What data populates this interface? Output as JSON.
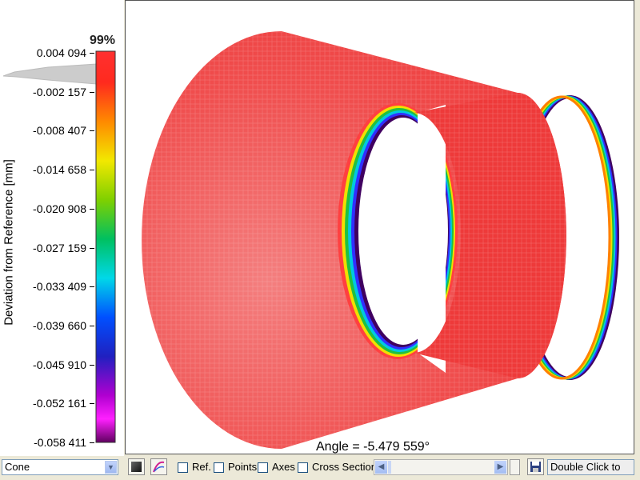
{
  "legend": {
    "percent": "99%",
    "axis_label": "Deviation from Reference [mm]",
    "ticks": [
      "0.004 094",
      "-0.002 157",
      "-0.008 407",
      "-0.014 658",
      "-0.020 908",
      "-0.027 159",
      "-0.033 409",
      "-0.039 660",
      "-0.045 910",
      "-0.052 161",
      "-0.058 411"
    ],
    "gradient_colors": [
      "#ff3030",
      "#ff2a20",
      "#ff8c00",
      "#f5e800",
      "#8ed400",
      "#00c060",
      "#00d8e8",
      "#0050ff",
      "#2020c0",
      "#b000d0",
      "#ff20ff",
      "#600060"
    ]
  },
  "view": {
    "angle_readout": "Angle = -5.479 559°",
    "surface_color": "#ee3a3a"
  },
  "toolbar": {
    "shape_select_value": "Cone",
    "checkboxes": [
      {
        "label": "Ref.",
        "checked": false
      },
      {
        "label": "Points",
        "checked": false
      },
      {
        "label": "Axes",
        "checked": false
      },
      {
        "label": "Cross Section",
        "checked": false
      }
    ],
    "status_text": "Double Click to"
  }
}
